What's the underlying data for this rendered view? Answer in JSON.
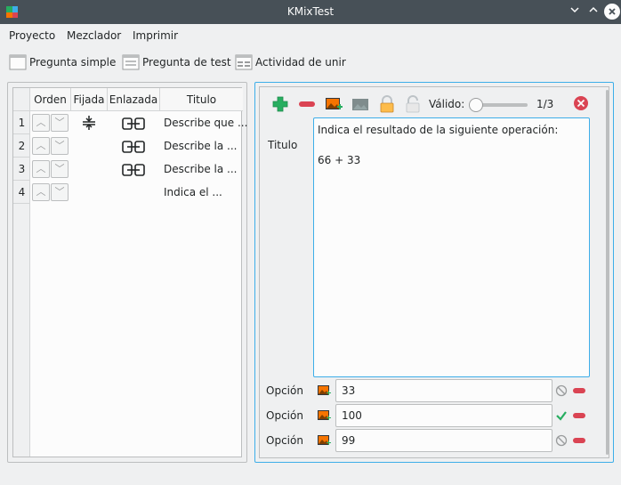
{
  "window": {
    "title": "KMixTest"
  },
  "menu": [
    "Proyecto",
    "Mezclador",
    "Imprimir"
  ],
  "toolbar": {
    "simple": "Pregunta simple",
    "test": "Pregunta de test",
    "join": "Actividad de unir"
  },
  "table": {
    "headers": {
      "order": "Orden",
      "fixed": "Fijada",
      "linked": "Enlazada",
      "title": "Titulo"
    },
    "rows": [
      {
        "num": "1",
        "title": "Describe que ..."
      },
      {
        "num": "2",
        "title": "Describe la ..."
      },
      {
        "num": "3",
        "title": "Describe la ..."
      },
      {
        "num": "4",
        "title": "Indica el ..."
      }
    ]
  },
  "editor": {
    "valid_label": "Válido:",
    "valid_value": "1/3",
    "title_label": "Titulo",
    "title_text": "Indica el resultado de la siguiente operación:\n\n66 + 33",
    "options": [
      {
        "label": "Opción",
        "value": "33"
      },
      {
        "label": "Opción",
        "value": "100"
      },
      {
        "label": "Opción",
        "value": "99"
      }
    ]
  }
}
